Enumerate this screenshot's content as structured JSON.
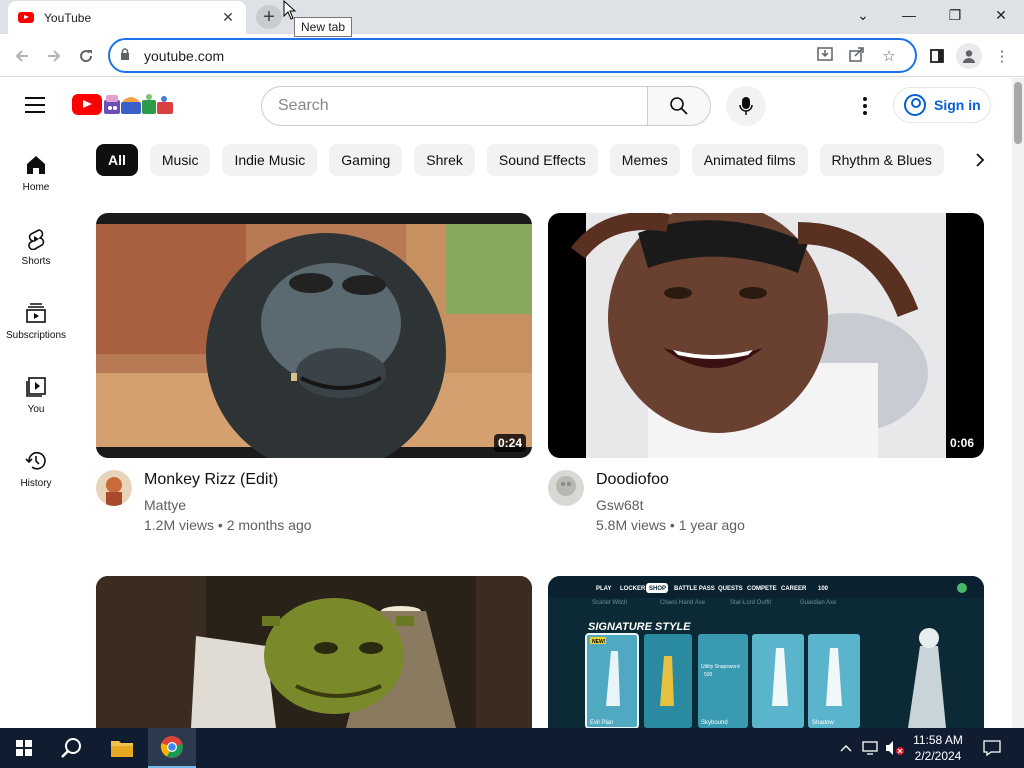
{
  "browser": {
    "tab_title": "YouTube",
    "tab_close": "✕",
    "new_tab_tooltip": "New tab",
    "url": "youtube.com",
    "window_controls": [
      "⌄",
      "—",
      "❐",
      "✕"
    ]
  },
  "youtube": {
    "search_placeholder": "Search",
    "sign_in_label": "Sign in",
    "sidebar": [
      {
        "label": "Home",
        "icon": "home-icon"
      },
      {
        "label": "Shorts",
        "icon": "shorts-icon"
      },
      {
        "label": "Subscriptions",
        "icon": "subscriptions-icon"
      },
      {
        "label": "You",
        "icon": "you-icon"
      },
      {
        "label": "History",
        "icon": "history-icon"
      }
    ],
    "chips": [
      "All",
      "Music",
      "Indie Music",
      "Gaming",
      "Shrek",
      "Sound Effects",
      "Memes",
      "Animated films",
      "Rhythm & Blues"
    ],
    "videos": [
      {
        "title": "Monkey Rizz (Edit)",
        "channel": "Mattye",
        "meta": "1.2M views • 2 months ago",
        "duration": "0:24"
      },
      {
        "title": "Doodiofoo",
        "channel": "Gsw68t",
        "meta": "5.8M views • 1 year ago",
        "duration": "0:06"
      },
      {
        "title": "",
        "channel": "",
        "meta": "",
        "duration": ""
      },
      {
        "title": "",
        "channel": "",
        "meta": "",
        "duration": ""
      }
    ],
    "fortnite_thumb": {
      "menu": [
        "PLAY",
        "LOCKER",
        "SHOP",
        "BATTLE PASS",
        "QUESTS",
        "COMPETE",
        "CAREER",
        "100"
      ],
      "subnav": [
        "Scarlet Witch",
        "Chaos Hand Axe",
        "Star-Lord Outfit",
        "Guardian Axe"
      ],
      "heading": "SIGNATURE STYLE",
      "new_badge": "NEW!",
      "card_texts": [
        "Utility Snapsword",
        "500",
        "Evil Plan",
        "Skybound",
        "Shadow"
      ]
    }
  },
  "taskbar": {
    "time": "11:58 AM",
    "date": "2/2/2024"
  },
  "colors": {
    "yt_red": "#ff0000",
    "link_blue": "#065fd4",
    "focus_blue": "#1a73e8",
    "taskbar": "#101d31"
  }
}
